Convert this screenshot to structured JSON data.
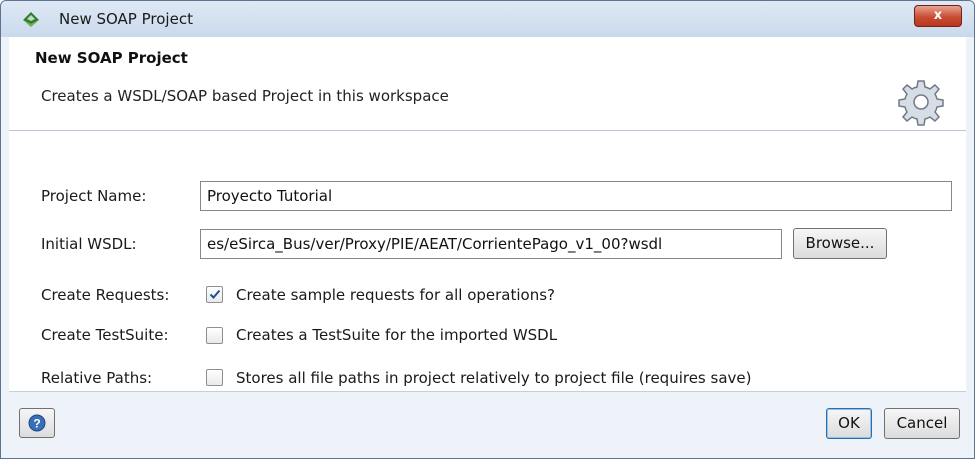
{
  "window": {
    "title": "New SOAP Project",
    "close_label": "x",
    "app_icon": "soapui-icon"
  },
  "header": {
    "title": "New SOAP Project",
    "description": "Creates a WSDL/SOAP based Project in this workspace",
    "icon": "gear-icon"
  },
  "form": {
    "project_name": {
      "label": "Project Name:",
      "value": "Proyecto Tutorial"
    },
    "initial_wsdl": {
      "label": "Initial WSDL:",
      "value": "es/eSirca_Bus/ver/Proxy/PIE/AEAT/CorrientePago_v1_00?wsdl",
      "browse_label": "Browse..."
    },
    "create_requests": {
      "label": "Create Requests:",
      "checkbox_label": "Create sample requests for all operations?",
      "checked": true
    },
    "create_testsuite": {
      "label": "Create TestSuite:",
      "checkbox_label": "Creates a TestSuite for the imported WSDL",
      "checked": false
    },
    "relative_paths": {
      "label": "Relative Paths:",
      "checkbox_label": "Stores all file paths in project relatively to project file (requires save)",
      "checked": false
    }
  },
  "footer": {
    "help_icon": "help-icon",
    "ok_label": "OK",
    "cancel_label": "Cancel"
  },
  "colors": {
    "window_bg": "#eef3f9",
    "titlebar": "#c9d9ec",
    "close_button": "#c74d33",
    "panel_bg": "#ffffff",
    "focus_border": "#2f6ea8"
  }
}
